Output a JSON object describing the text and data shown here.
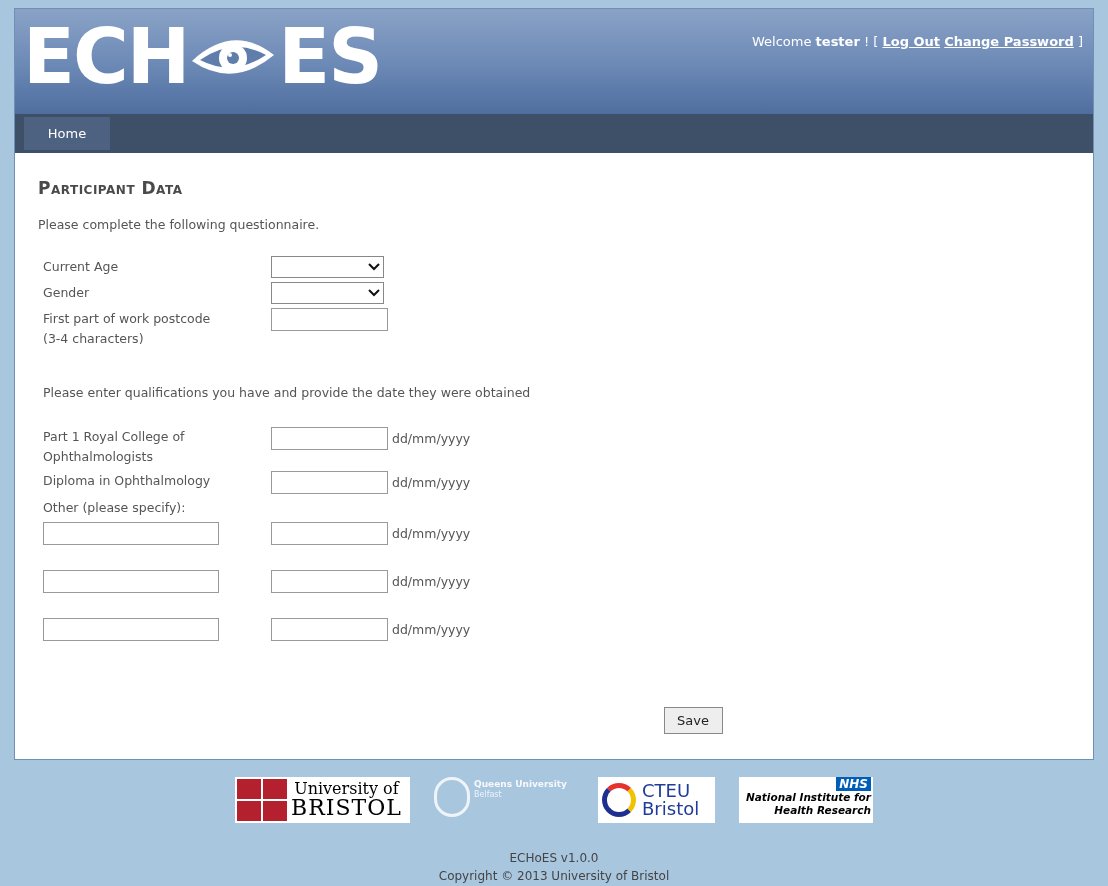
{
  "header": {
    "logo": {
      "left": "ECH",
      "right": "ES"
    },
    "welcome": {
      "greeting": "Welcome **tester** ! [",
      "links": [
        "Log Out",
        "Change Password"
      ],
      "closing": "]"
    }
  },
  "nav": [
    {
      "label": "Home",
      "selected": true
    }
  ],
  "page": {
    "title": "Participant Data",
    "intro": "Please complete the following questionnaire.",
    "questions": [
      {
        "label": "Current Age",
        "kind": "select"
      },
      {
        "label": "Gender",
        "kind": "select"
      },
      {
        "label": "First part of work postcode (3-4 characters)",
        "kind": "text"
      }
    ],
    "qualifications_intro": "Please enter qualifications you have and provide the date they were obtained",
    "qualifications": [
      {
        "label": "Part 1 Royal College of Ophthalmologists",
        "date_hint": "dd/mm/yyyy"
      },
      {
        "label": "Diploma in Ophthalmology",
        "date_hint": "dd/mm/yyyy"
      }
    ],
    "other_label": "Other (please specify):",
    "others": [
      {
        "date_hint": "dd/mm/yyyy"
      },
      {
        "date_hint": "dd/mm/yyyy"
      },
      {
        "date_hint": "dd/mm/yyyy"
      }
    ],
    "save": "Save"
  },
  "footer": {
    "logos": [
      {
        "kind": "bristol",
        "lines": [
          "University of",
          "BRISTOL"
        ]
      },
      {
        "kind": "queens",
        "lines": [
          "Queens University",
          "Belfast"
        ]
      },
      {
        "kind": "cteu",
        "lines": [
          "CTEU",
          "Bristol"
        ]
      },
      {
        "kind": "nihr",
        "badge": "NHS",
        "lines": [
          "National Institute for",
          "Health Research"
        ]
      }
    ],
    "version": "ECHoES v1.0.0",
    "copyright": "Copyright © 2013 University of Bristol"
  }
}
